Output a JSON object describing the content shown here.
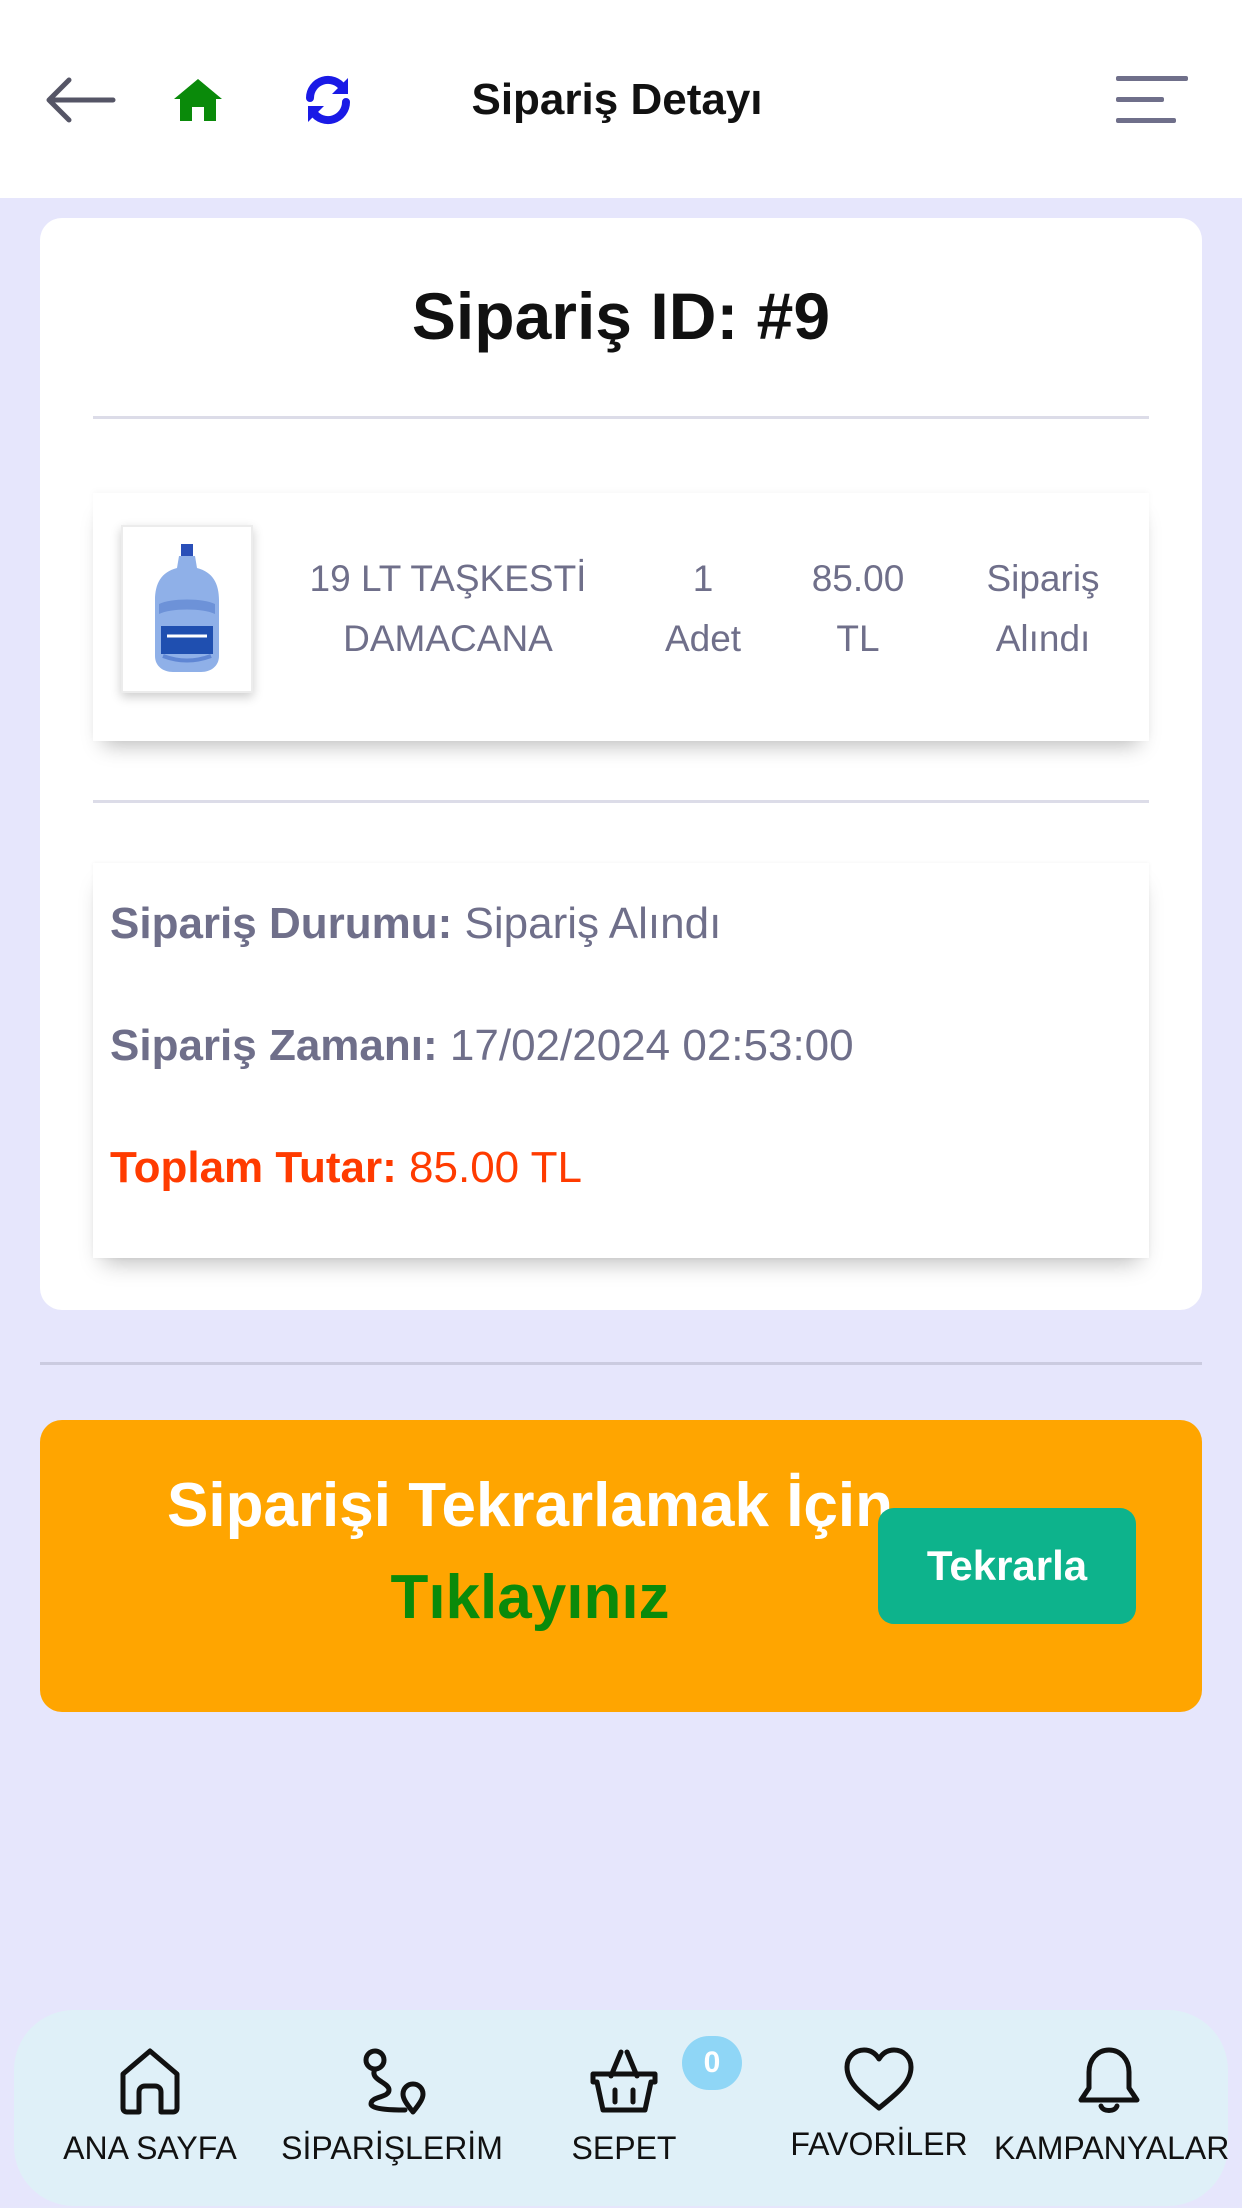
{
  "header": {
    "title": "Sipariş Detayı",
    "icons": {
      "back": "arrow-left-icon",
      "home": "home-icon",
      "refresh": "refresh-icon",
      "menu": "menu-icon"
    },
    "colors": {
      "home": "#0a8a0a",
      "refresh": "#1a1ae6",
      "back": "#555566"
    }
  },
  "order": {
    "id_label": "Sipariş ID: #9",
    "item": {
      "name": "19 LT TAŞKESTİ DAMACANA",
      "qty_number": "1",
      "qty_unit": "Adet",
      "price_value": "85.00",
      "price_currency": "TL",
      "status_line1": "Sipariş",
      "status_line2": "Alındı"
    },
    "info": {
      "status_label": "Sipariş Durumu:",
      "status_value": "Sipariş Alındı",
      "time_label": "Sipariş Zamanı:",
      "time_value": "17/02/2024 02:53:00",
      "total_label": "Toplam Tutar:",
      "total_value": "85.00 TL"
    }
  },
  "repeat": {
    "text_line1": "Siparişi Tekrarlamak İçin",
    "text_line2": "Tıklayınız",
    "button": "Tekrarla",
    "colors": {
      "banner": "#ffa500",
      "button": "#0db38c",
      "accent": "#0a8a0a"
    }
  },
  "bottom_nav": {
    "items": [
      {
        "label": "ANA SAYFA",
        "icon": "home-outline-icon"
      },
      {
        "label": "SİPARİŞLERİM",
        "icon": "route-icon"
      },
      {
        "label": "SEPET",
        "icon": "basket-icon"
      },
      {
        "label": "FAVORİLER",
        "icon": "heart-icon"
      },
      {
        "label": "KAMPANYALAR",
        "icon": "bell-icon"
      }
    ],
    "cart_count": "0"
  }
}
